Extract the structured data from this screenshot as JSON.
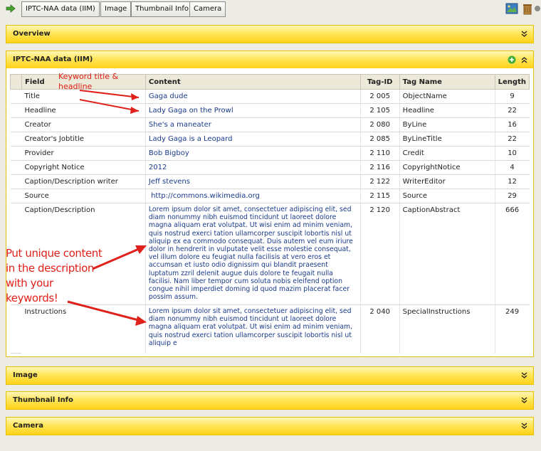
{
  "toolbar": {
    "tabs": [
      "IPTC-NAA data (IIM)",
      "Image",
      "Thumbnail Info",
      "Camera"
    ]
  },
  "panels": {
    "overview": "Overview",
    "iptc": "IPTC-NAA data (IIM)",
    "image": "Image",
    "thumbnail": "Thumbnail Info",
    "camera": "Camera"
  },
  "table": {
    "headers": [
      "Field",
      "Content",
      "Tag-ID",
      "Tag Name",
      "Length"
    ],
    "rows": [
      {
        "field": "Title",
        "content": "Gaga dude",
        "tag": "2 005",
        "tagname": "ObjectName",
        "length": "9"
      },
      {
        "field": "Headline",
        "content": "Lady Gaga on the Prowl",
        "tag": "2 105",
        "tagname": "Headline",
        "length": "22"
      },
      {
        "field": "Creator",
        "content": "She's a maneater",
        "tag": "2 080",
        "tagname": "ByLine",
        "length": "16"
      },
      {
        "field": "Creator's Jobtitle",
        "content": "Lady Gaga is a Leopard",
        "tag": "2 085",
        "tagname": "ByLineTitle",
        "length": "22"
      },
      {
        "field": "Provider",
        "content": "Bob Bigboy",
        "tag": "2 110",
        "tagname": "Credit",
        "length": "10"
      },
      {
        "field": "Copyright Notice",
        "content": "2012",
        "tag": "2 116",
        "tagname": "CopyrightNotice",
        "length": "4"
      },
      {
        "field": "Caption/Description writer",
        "content": "Jeff stevens",
        "tag": "2 122",
        "tagname": "WriterEditor",
        "length": "12"
      },
      {
        "field": "Source",
        "content": " http://commons.wikimedia.org",
        "tag": "2 115",
        "tagname": "Source",
        "length": "29"
      },
      {
        "field": "Caption/Description",
        "content": "Lorem ipsum dolor sit amet, consectetuer adipiscing elit, sed diam nonummy nibh euismod tincidunt ut laoreet dolore magna aliquam erat volutpat. Ut wisi enim ad minim veniam, quis nostrud exerci tation ullamcorper suscipit lobortis nisl ut aliquip ex ea commodo consequat. Duis autem vel eum iriure dolor in hendrerit in vulputate velit esse molestie consequat, vel illum dolore eu feugiat nulla facilisis at vero eros et accumsan et iusto odio dignissim qui blandit praesent luptatum zzril delenit augue duis dolore te feugait nulla facilisi. Nam liber tempor cum soluta nobis eleifend option congue nihil imperdiet doming id quod mazim placerat facer possim assum.",
        "tag": "2 120",
        "tagname": "CaptionAbstract",
        "length": "666"
      },
      {
        "field": "Instructions",
        "content": "Lorem ipsum dolor sit amet, consectetuer adipiscing elit, sed diam nonummy nibh euismod tincidunt ut laoreet dolore magna aliquam erat volutpat. Ut wisi enim ad minim veniam, quis nostrud exerci tation ullamcorper suscipit lobortis nisl ut aliquip e",
        "tag": "2 040",
        "tagname": "SpecialInstructions",
        "length": "249"
      }
    ]
  },
  "annotations": {
    "keyword": "Keyword title & headline",
    "unique": "Put unique content in the description with your keywords!"
  },
  "colors": {
    "annotation": "#e0201a",
    "panel_accent": "#ffd21a",
    "content_link": "#1a3a8a"
  }
}
